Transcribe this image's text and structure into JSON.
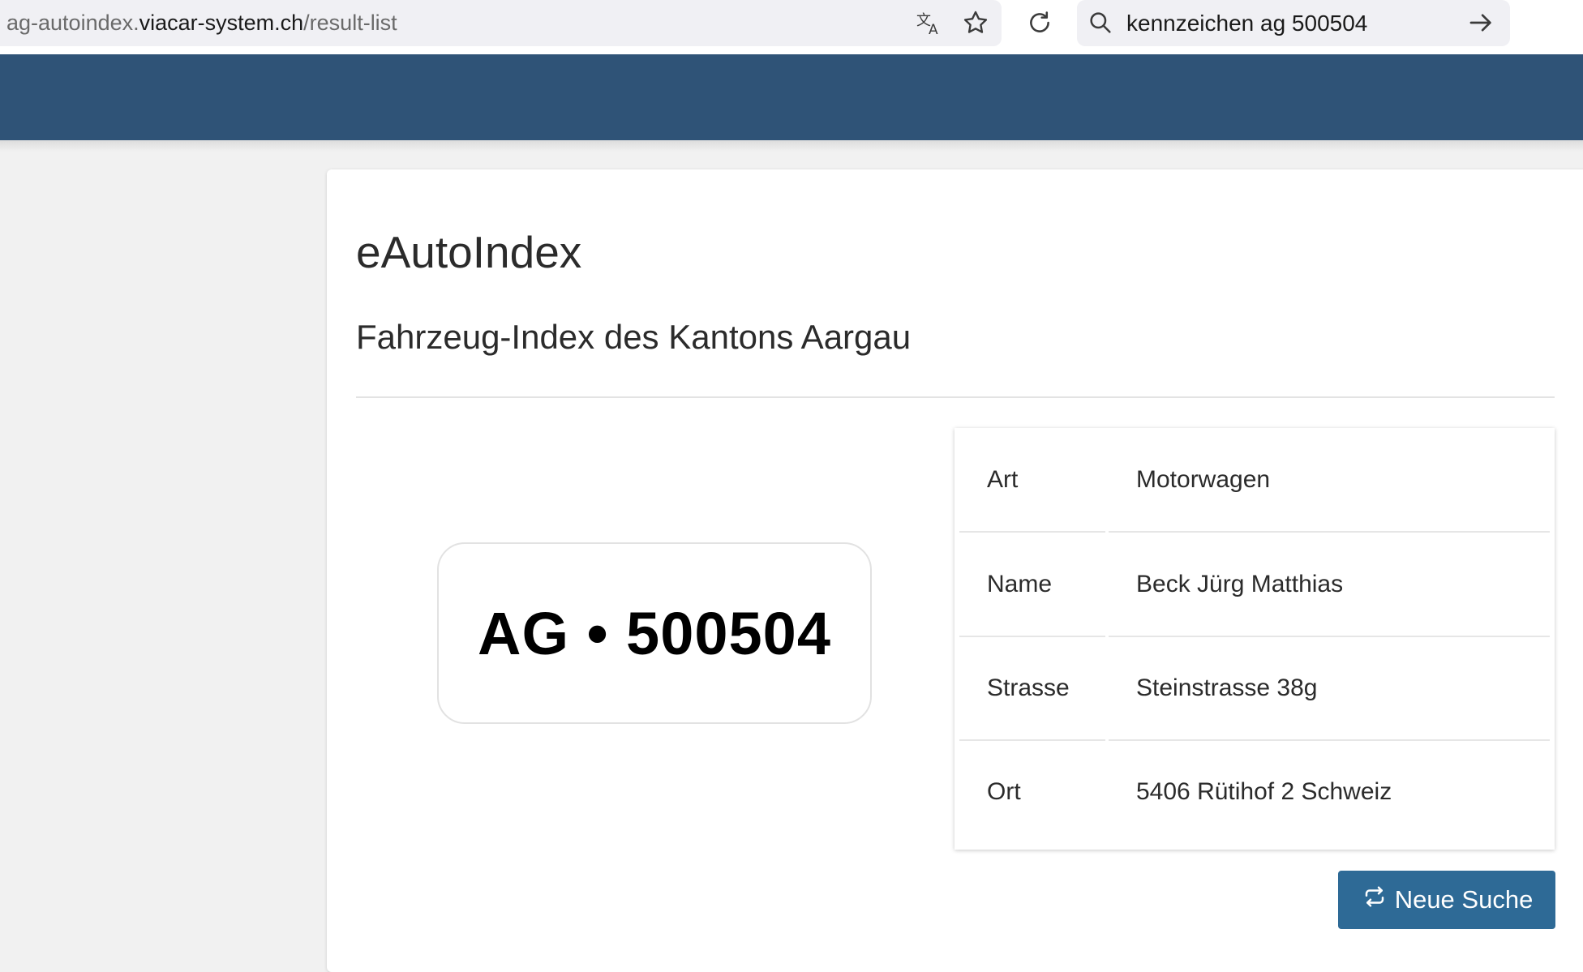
{
  "browser": {
    "url_prefix": "ag-autoindex.",
    "url_host": "viacar-system.ch",
    "url_path": "/result-list",
    "search_query": "kennzeichen ag 500504",
    "icons": [
      "translate-icon",
      "bookmark-star-icon",
      "reload-icon",
      "search-icon",
      "go-arrow-icon"
    ]
  },
  "page": {
    "title": "eAutoIndex",
    "subtitle": "Fahrzeug-Index des Kantons Aargau"
  },
  "plate": {
    "text": "AG • 500504"
  },
  "vehicle_info": {
    "rows": [
      {
        "label": "Art",
        "value": "Motorwagen"
      },
      {
        "label": "Name",
        "value": "Beck Jürg Matthias"
      },
      {
        "label": "Strasse",
        "value": "Steinstrasse 38g"
      },
      {
        "label": "Ort",
        "value": "5406 Rütihof 2 Schweiz"
      }
    ]
  },
  "actions": {
    "new_search_label": "Neue Suche",
    "new_search_icon": "repeat-icon"
  },
  "colors": {
    "header": "#2f5377",
    "button": "#2e6a96",
    "page_bg": "#f1f1f1"
  }
}
